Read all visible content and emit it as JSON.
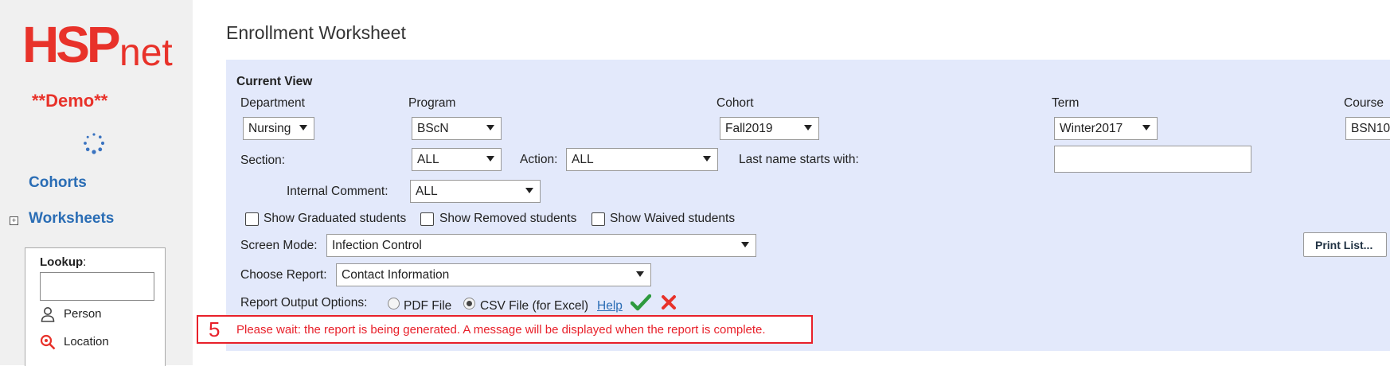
{
  "sidebar": {
    "logo_text": "HSPnet",
    "demo_label": "**Demo**",
    "nav": {
      "cohorts": "Cohorts",
      "worksheets": "Worksheets",
      "expand_symbol": "+"
    },
    "lookup": {
      "title": "Lookup",
      "title_suffix": ":",
      "input_value": "",
      "person": "Person",
      "location": "Location"
    }
  },
  "page_title": "Enrollment Worksheet",
  "filters": {
    "current_view": "Current View",
    "department": {
      "label": "Department",
      "value": "Nursing"
    },
    "program": {
      "label": "Program",
      "value": "BScN"
    },
    "cohort": {
      "label": "Cohort",
      "value": "Fall2019"
    },
    "term": {
      "label": "Term",
      "value": "Winter2017"
    },
    "course": {
      "label": "Course",
      "value": "BSN10"
    },
    "section": {
      "label": "Section:",
      "value": "ALL"
    },
    "action": {
      "label": "Action:",
      "value": "ALL"
    },
    "last_name": {
      "label": "Last name starts with:",
      "value": ""
    },
    "internal_comment": {
      "label": "Internal Comment:",
      "value": "ALL"
    }
  },
  "checkboxes": {
    "graduated": {
      "label": "Show Graduated students",
      "checked": false
    },
    "removed": {
      "label": "Show Removed students",
      "checked": false
    },
    "waived": {
      "label": "Show Waived students",
      "checked": false
    }
  },
  "screen_mode": {
    "label": "Screen Mode:",
    "value": "Infection Control"
  },
  "print_list": "Print List...",
  "choose_report": {
    "label": "Choose Report:",
    "value": "Contact Information"
  },
  "report_output": {
    "label": "Report Output Options:",
    "pdf": "PDF File",
    "csv": "CSV File (for Excel)",
    "selected": "csv",
    "help": "Help"
  },
  "message": {
    "number": "5",
    "text": "Please wait: the report is being generated. A message will be displayed when the report is complete."
  },
  "colors": {
    "brand": "#e8322a",
    "link": "#2a6db5",
    "panel": "#e3e9fb",
    "confirm": "#2e9a3e",
    "cancel": "#e8322a"
  }
}
